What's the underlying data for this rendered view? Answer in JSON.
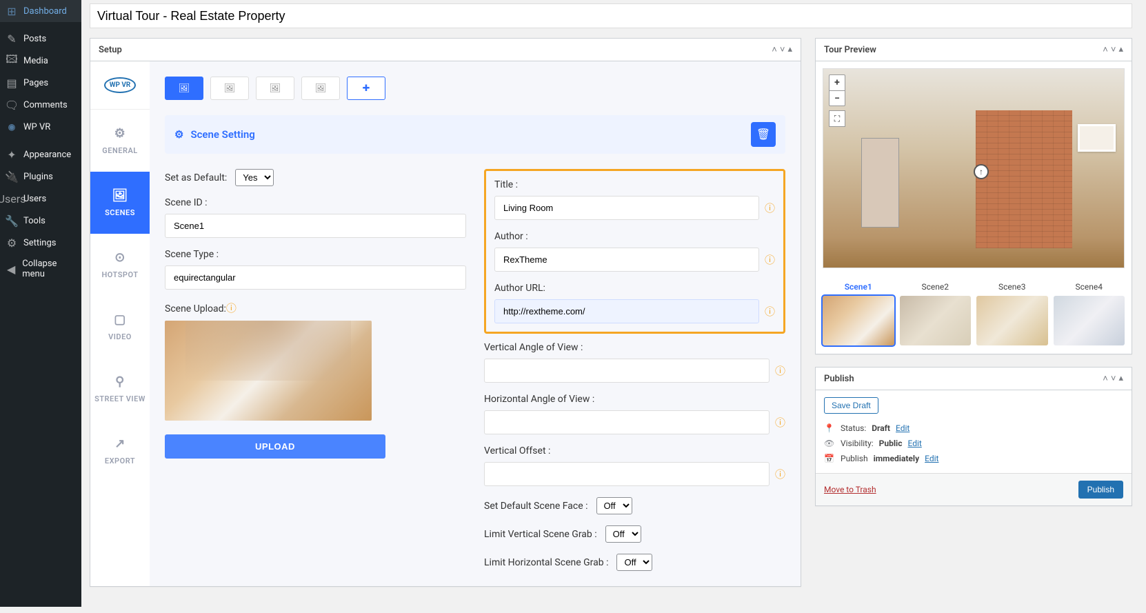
{
  "sidebar": [
    {
      "label": "Dashboard",
      "icon": "⊞"
    },
    {
      "label": "Posts",
      "icon": "✎"
    },
    {
      "label": "Media",
      "icon": "🖾"
    },
    {
      "label": "Pages",
      "icon": "▤"
    },
    {
      "label": "Comments",
      "icon": "🗨"
    },
    {
      "label": "WP VR",
      "icon": "◉"
    },
    {
      "label": "Appearance",
      "icon": "✦"
    },
    {
      "label": "Plugins",
      "icon": "🔌"
    },
    {
      "label": "Users",
      "icon": "👤"
    },
    {
      "label": "Tools",
      "icon": "🔧"
    },
    {
      "label": "Settings",
      "icon": "⚙"
    },
    {
      "label": "Collapse menu",
      "icon": "◀"
    }
  ],
  "pageTitle": "Virtual Tour - Real Estate Property",
  "setupBox": {
    "title": "Setup"
  },
  "vtabs": [
    {
      "label": "GENERAL",
      "icon": "⚙"
    },
    {
      "label": "SCENES",
      "icon": "🖼",
      "active": true
    },
    {
      "label": "HOTSPOT",
      "icon": "⊙"
    },
    {
      "label": "VIDEO",
      "icon": "▢"
    },
    {
      "label": "STREET VIEW",
      "icon": "⚲"
    },
    {
      "label": "EXPORT",
      "icon": "↗"
    }
  ],
  "sectionTitle": "Scene Setting",
  "leftFields": {
    "setDefaultLabel": "Set as Default:",
    "setDefaultValue": "Yes",
    "sceneIdLabel": "Scene ID :",
    "sceneIdValue": "Scene1",
    "sceneTypeLabel": "Scene Type :",
    "sceneTypeValue": "equirectangular",
    "sceneUploadLabel": "Scene Upload:",
    "uploadBtn": "UPLOAD"
  },
  "rightFields": {
    "titleLabel": "Title :",
    "titleValue": "Living Room",
    "authorLabel": "Author :",
    "authorValue": "RexTheme",
    "authorUrlLabel": "Author URL:",
    "authorUrlValue": "http://rextheme.com/",
    "vAngleLabel": "Vertical Angle of View :",
    "vAngleValue": "",
    "hAngleLabel": "Horizontal Angle of View :",
    "hAngleValue": "",
    "vOffsetLabel": "Vertical Offset :",
    "vOffsetValue": "",
    "defaultFaceLabel": "Set Default Scene Face :",
    "defaultFaceValue": "Off",
    "limitVLabel": "Limit Vertical Scene Grab :",
    "limitVValue": "Off",
    "limitHLabel": "Limit Horizontal Scene Grab :",
    "limitHValue": "Off"
  },
  "tourPreview": {
    "title": "Tour Preview",
    "scenes": [
      "Scene1",
      "Scene2",
      "Scene3",
      "Scene4"
    ]
  },
  "publish": {
    "title": "Publish",
    "saveDraft": "Save Draft",
    "statusLabel": "Status:",
    "statusValue": "Draft",
    "visibilityLabel": "Visibility:",
    "visibilityValue": "Public",
    "publishLabel": "Publish",
    "publishValue": "immediately",
    "editLabel": "Edit",
    "moveTrash": "Move to Trash",
    "publishBtn": "Publish"
  }
}
